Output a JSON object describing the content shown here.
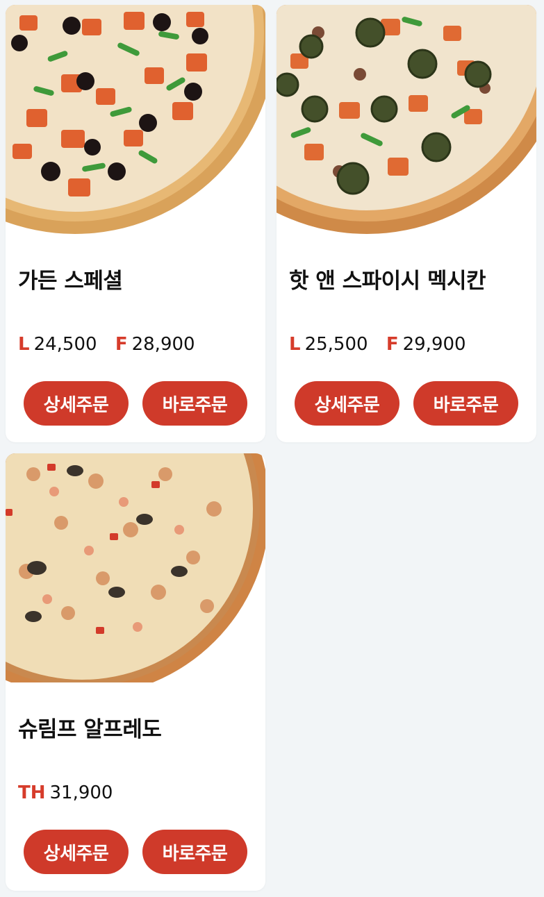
{
  "products": [
    {
      "name": "가든 스페셜",
      "prices": [
        {
          "size": "L",
          "amount": "24,500"
        },
        {
          "size": "F",
          "amount": "28,900"
        }
      ],
      "detail_order_label": "상세주문",
      "quick_order_label": "바로주문"
    },
    {
      "name": "핫 앤 스파이시 멕시칸",
      "prices": [
        {
          "size": "L",
          "amount": "25,500"
        },
        {
          "size": "F",
          "amount": "29,900"
        }
      ],
      "detail_order_label": "상세주문",
      "quick_order_label": "바로주문"
    },
    {
      "name": "슈림프 알프레도",
      "prices": [
        {
          "size": "TH",
          "amount": "31,900"
        }
      ],
      "detail_order_label": "상세주문",
      "quick_order_label": "바로주문"
    }
  ],
  "colors": {
    "accent": "#cf3a2a",
    "price_label": "#d63c2b",
    "background": "#f2f5f7",
    "card": "#ffffff"
  }
}
